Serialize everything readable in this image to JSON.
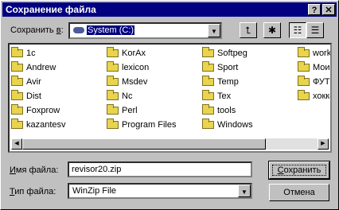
{
  "window": {
    "title": "Сохранение файла",
    "help_button": "?",
    "close_button": "✕"
  },
  "save_in": {
    "label_prefix": "Сохранить ",
    "label_hotkey": "в",
    "label_suffix": ":",
    "value": "System (C:)"
  },
  "toolbar": {
    "up_folder_icon": "up-folder-icon",
    "new_folder_icon": "new-folder-icon",
    "list_view_icon": "list-view-icon",
    "details_view_icon": "details-view-icon"
  },
  "files": {
    "columns": [
      [
        "1c",
        "Andrew",
        "Avir",
        "Dist",
        "Foxprow",
        "kazantesv"
      ],
      [
        "KorAx",
        "lexicon",
        "Msdev",
        "Nc",
        "Perl",
        "Program Files"
      ],
      [
        "Softpeg",
        "Sport",
        "Temp",
        "Tex",
        "tools",
        "Windows"
      ],
      [
        "work",
        "Мои д",
        "ФУТ",
        "хокке"
      ]
    ]
  },
  "file_name": {
    "label_hotkey": "И",
    "label_rest": "мя файла:",
    "value": "revisor20.zip"
  },
  "file_type": {
    "label_hotkey": "Т",
    "label_rest": "ип файла:",
    "value": "WinZip File"
  },
  "buttons": {
    "save_hotkey": "С",
    "save_rest": "охранить",
    "cancel": "Отмена"
  },
  "colors": {
    "titlebar": "#000080",
    "face": "#c0c0c0",
    "folder": "#e8d44d"
  }
}
